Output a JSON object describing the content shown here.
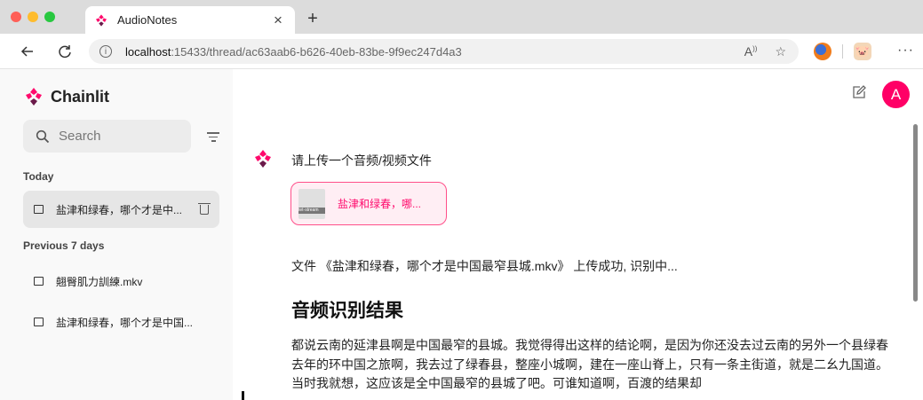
{
  "browser": {
    "tab_title": "AudioNotes",
    "tab_close": "×",
    "new_tab": "+",
    "url_host": "localhost",
    "url_path": ":15433/thread/ac63aab6-b626-40eb-83be-9f9ec247d4a3",
    "read_aloud": "Aₓ",
    "more": "···",
    "icons": [
      "back-arrow-icon",
      "reload-icon",
      "info-icon",
      "read-aloud-icon",
      "favorite-star-icon",
      "extension-icon",
      "pig-extension-icon",
      "more-icon"
    ]
  },
  "sidebar": {
    "logo_text": "Chainlit",
    "search_placeholder": "Search",
    "sections": [
      {
        "title": "Today",
        "threads": [
          {
            "label": "盐津和绿春，哪个才是中..."
          }
        ]
      },
      {
        "title": "Previous 7 days",
        "threads": [
          {
            "label": "翹臀肌力訓練.mkv"
          },
          {
            "label": "盐津和绿春，哪个才是中国..."
          }
        ]
      }
    ]
  },
  "main": {
    "avatar_letter": "A",
    "prompt": "请上传一个音频/视频文件",
    "file_name": "盐津和绿春，哪...",
    "file_thumb_text": "tet-stream",
    "upload_status": "文件 《盐津和绿春，哪个才是中国最窄县城.mkv》 上传成功, 识别中...",
    "result_heading": "音频识别结果",
    "transcript": "都说云南的延津县啊是中国最窄的县城。我觉得得出这样的结论啊，是因为你还没去过云南的另外一个县绿春去年的环中国之旅啊，我去过了绿春县，整座小城啊，建在一座山脊上，只有一条主街道，就是二幺九国道。当时我就想，这应该是全中国最窄的县城了吧。可谁知道啊，百渡的结果却"
  },
  "colors": {
    "brand": "#ff0a6c",
    "avatar": "#ff0066",
    "sidebar_bg": "#f9f9f9"
  }
}
